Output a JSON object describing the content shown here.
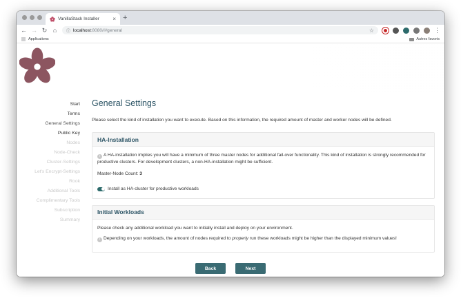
{
  "browser": {
    "tab_title": "VanillaStack Installer",
    "tab_close": "×",
    "new_tab": "+",
    "url_host": "localhost",
    "url_rest": ":8080/#/general",
    "bookmarks": {
      "apps_label": "Applications",
      "other_label": "Autres favoris"
    }
  },
  "sidebar": {
    "items": [
      {
        "label": "Start"
      },
      {
        "label": "Terms"
      },
      {
        "label": "General Settings"
      },
      {
        "label": "Public Key"
      },
      {
        "label": "Nodes"
      },
      {
        "label": "Node-Check"
      },
      {
        "label": "Cluster-Settings"
      },
      {
        "label": "Let's Encrypt-Settings"
      },
      {
        "label": "Rook"
      },
      {
        "label": "Additional Tools"
      },
      {
        "label": "Complimentary Tools"
      },
      {
        "label": "Subscription"
      },
      {
        "label": "Summary"
      }
    ]
  },
  "main": {
    "title": "General Settings",
    "intro": "Please select the kind of installation you want to execute. Based on this information, the required amount of master and worker nodes will be defined.",
    "ha": {
      "heading": "HA-Installation",
      "info": "A HA-installation implies you will have a minimum of three master nodes for additional fail-over functionality. This kind of installation is strongly recommended for productive clusters. For development clusters, a non-HA-installation might be sufficient.",
      "master_count_label": "Master-Node Count: ",
      "master_count_value": "3",
      "toggle_label": "Install as HA-cluster for productive workloads",
      "toggle_on": true
    },
    "workloads": {
      "heading": "Initial Workloads",
      "text": "Please check any additional workload you want to initially install and deploy on your environment.",
      "info_before": "Depending on your workloads, the amount of nodes required to ",
      "info_em": "properly",
      "info_after": " run these workloads might be higher than the displayed minimum values!"
    }
  },
  "footer": {
    "back_label": "Back",
    "next_label": "Next"
  },
  "colors": {
    "accent": "#3a6b73",
    "title": "#2d5566",
    "logo": "#8c5560"
  },
  "icons": [
    "favicon-flower-icon",
    "back-arrow-icon",
    "forward-arrow-icon",
    "reload-icon",
    "home-icon",
    "lock-icon",
    "star-icon",
    "info-icon"
  ]
}
